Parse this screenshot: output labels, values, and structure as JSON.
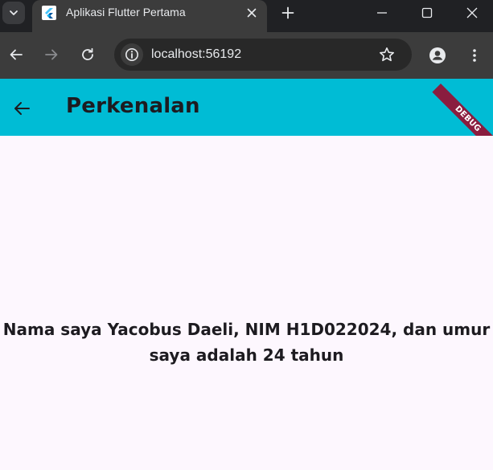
{
  "browser": {
    "tab": {
      "title": "Aplikasi Flutter Pertama",
      "favicon": "flutter-logo-icon"
    },
    "address_bar": {
      "url": "localhost:56192"
    },
    "icons": {
      "tab_search": "chevron-down-icon",
      "tab_close": "close-icon",
      "new_tab": "plus-icon",
      "minimize": "minimize-icon",
      "maximize": "maximize-icon",
      "close_window": "close-icon",
      "back": "arrow-left-icon",
      "forward": "arrow-right-icon",
      "reload": "reload-icon",
      "site_info": "info-icon",
      "bookmark": "star-icon",
      "profile": "person-icon",
      "menu": "three-dots-vertical-icon"
    },
    "colors": {
      "tabbar": "#202124",
      "toolbar": "#3c3c3c",
      "omnibox": "#282828"
    }
  },
  "app": {
    "appbar": {
      "title": "Perkenalan",
      "back_icon": "arrow-left-icon",
      "color": "#00bcd5"
    },
    "debug_banner": "DEBUG",
    "body": {
      "text": "Nama saya Yacobus Daeli, NIM H1D022024, dan umur saya adalah 24 tahun",
      "background": "#fdf7fe"
    }
  }
}
